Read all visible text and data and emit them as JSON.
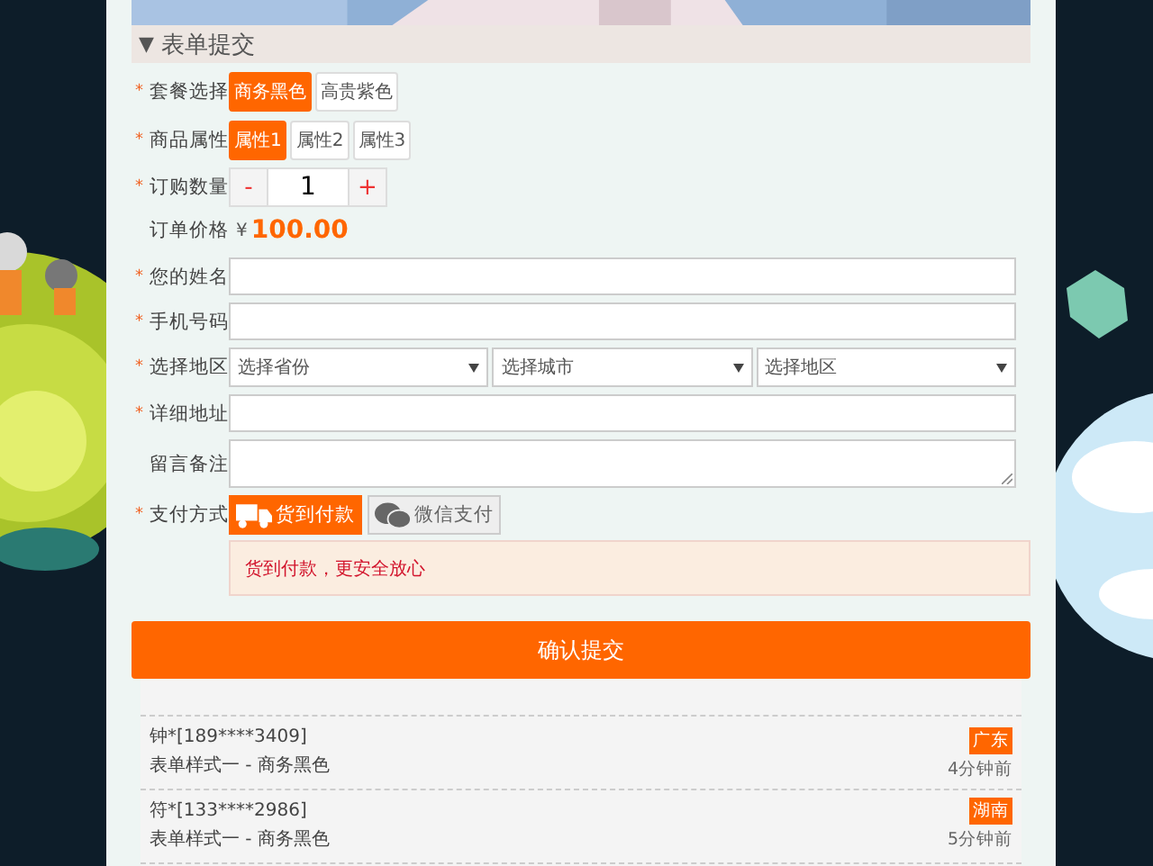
{
  "section": {
    "toggle": "▼",
    "title": "表单提交"
  },
  "form": {
    "rows": [
      {
        "kind": "options",
        "mark": "*",
        "label": "套餐选择",
        "options": [
          {
            "label": "商务黑色",
            "selected": true
          },
          {
            "label": "高贵紫色",
            "selected": false
          }
        ]
      },
      {
        "kind": "options",
        "mark": "*",
        "label": "商品属性",
        "options": [
          {
            "label": "属性1",
            "selected": true
          },
          {
            "label": "属性2",
            "selected": false
          },
          {
            "label": "属性3",
            "selected": false
          }
        ]
      },
      {
        "kind": "quantity",
        "mark": "*",
        "label": "订购数量",
        "minus": "-",
        "value": "1",
        "plus": "+"
      },
      {
        "kind": "price",
        "label": "订单价格",
        "currency": "¥",
        "amount": "100.00"
      },
      {
        "kind": "text",
        "mark": "*",
        "label": "您的姓名"
      },
      {
        "kind": "text",
        "mark": "*",
        "label": "手机号码"
      },
      {
        "kind": "selects",
        "mark": "*",
        "label": "选择地区",
        "selects": [
          "选择省份",
          "选择城市",
          "选择地区"
        ]
      },
      {
        "kind": "text",
        "mark": "*",
        "label": "详细地址"
      },
      {
        "kind": "textarea",
        "label": "留言备注"
      },
      {
        "kind": "payment",
        "mark": "*",
        "label": "支付方式",
        "methods": [
          {
            "kind": "truck",
            "label": "货到付款",
            "selected": true
          },
          {
            "kind": "chat",
            "label": "微信支付",
            "selected": false
          }
        ],
        "notice": "货到付款，更安全放心"
      }
    ]
  },
  "submit": "确认提交",
  "orders": [
    {
      "buyer": "钟*[189****3409]",
      "item": "表单样式一 - 商务黑色",
      "region": "广东",
      "time": "4分钟前"
    },
    {
      "buyer": "符*[133****2986]",
      "item": "表单样式一 - 商务黑色",
      "region": "湖南",
      "time": "5分钟前"
    }
  ]
}
